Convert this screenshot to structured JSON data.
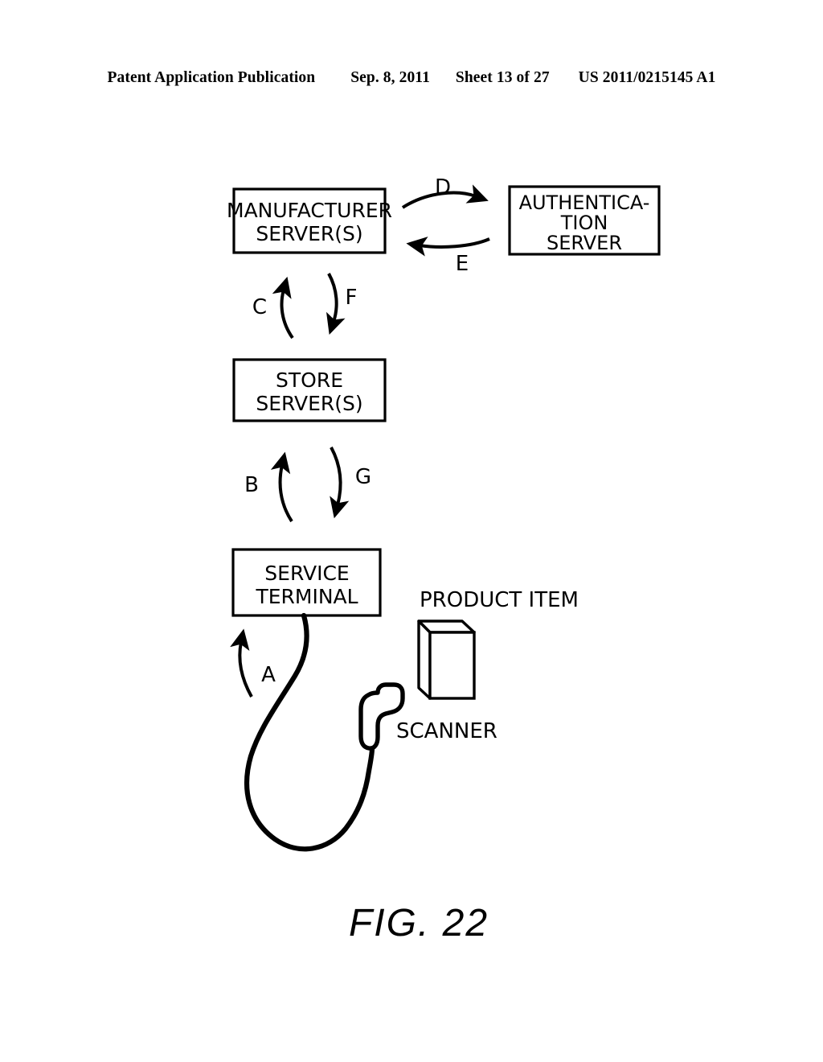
{
  "header": {
    "publication": "Patent Application Publication",
    "date": "Sep. 8, 2011",
    "sheet": "Sheet 13 of 27",
    "patent_number": "US 2011/0215145 A1"
  },
  "figure": {
    "caption": "FIG. 22",
    "nodes": [
      {
        "id": "manufacturer-server",
        "lines": [
          "MANUFACTURER",
          "SERVER(S)"
        ],
        "shape": "rectangle"
      },
      {
        "id": "authentication-server",
        "lines": [
          "AUTHENTICA-",
          "TION",
          "SERVER"
        ],
        "shape": "rectangle"
      },
      {
        "id": "store-server",
        "lines": [
          "STORE",
          "SERVER(S)"
        ],
        "shape": "rectangle"
      },
      {
        "id": "service-terminal",
        "lines": [
          "SERVICE",
          "TERMINAL"
        ],
        "shape": "rectangle"
      }
    ],
    "annotations": [
      {
        "id": "product-item",
        "label": "PRODUCT ITEM",
        "shape": "3d-box"
      },
      {
        "id": "scanner",
        "label": "SCANNER",
        "shape": "handheld-scanner-outline"
      }
    ],
    "flow_arrows": [
      {
        "letter": "A",
        "from": "scanner",
        "to": "service-terminal",
        "direction": "up"
      },
      {
        "letter": "B",
        "from": "service-terminal",
        "to": "store-server",
        "direction": "up"
      },
      {
        "letter": "C",
        "from": "store-server",
        "to": "manufacturer-server",
        "direction": "up"
      },
      {
        "letter": "D",
        "from": "manufacturer-server",
        "to": "authentication-server",
        "direction": "right"
      },
      {
        "letter": "E",
        "from": "authentication-server",
        "to": "manufacturer-server",
        "direction": "left"
      },
      {
        "letter": "F",
        "from": "manufacturer-server",
        "to": "store-server",
        "direction": "down"
      },
      {
        "letter": "G",
        "from": "store-server",
        "to": "service-terminal",
        "direction": "down"
      }
    ]
  },
  "colors": {
    "ink": "#000000",
    "paper": "#ffffff"
  }
}
